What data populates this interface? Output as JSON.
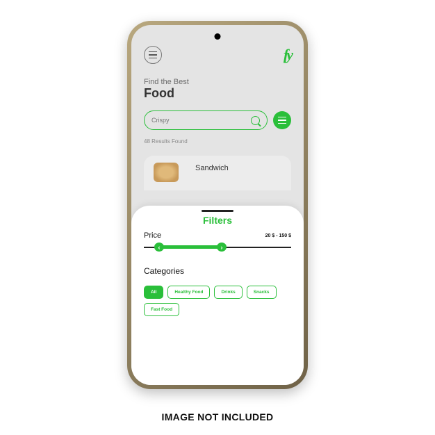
{
  "brand": {
    "logo_text": "fy"
  },
  "header": {
    "subtitle": "Find the Best",
    "title": "Food"
  },
  "search": {
    "placeholder": "Crispy"
  },
  "results": {
    "count_text": "48 Results Found"
  },
  "peek_card": {
    "title": "Sandwich"
  },
  "filters": {
    "title": "Filters",
    "price_label": "Price",
    "price_range": "20 $ - 150 $",
    "slider": {
      "left_symbol": "‹",
      "right_symbol": "›"
    },
    "categories_label": "Categories",
    "chips": {
      "all": "All",
      "healthy": "Healthy Food",
      "drinks": "Drinks",
      "snacks": "Snacks",
      "fastfood": "Fast Food"
    }
  },
  "disclaimer": "IMAGE NOT INCLUDED"
}
